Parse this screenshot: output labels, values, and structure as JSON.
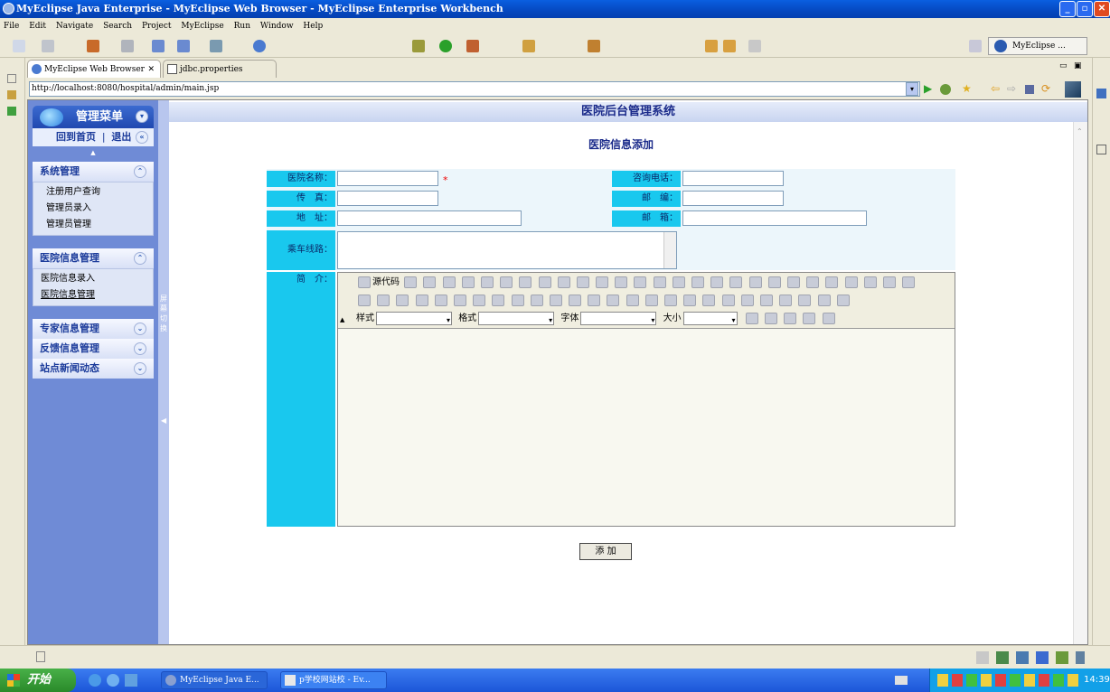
{
  "window": {
    "title": "MyEclipse Java Enterprise - MyEclipse Web Browser - MyEclipse Enterprise Workbench"
  },
  "menu": [
    "File",
    "Edit",
    "Navigate",
    "Search",
    "Project",
    "MyEclipse",
    "Run",
    "Window",
    "Help"
  ],
  "perspective": {
    "label": "MyEclipse ..."
  },
  "tabs": [
    {
      "label": "MyEclipse Web Browser"
    },
    {
      "label": "jdbc.properties"
    }
  ],
  "url": "http://localhost:8080/hospital/admin/main.jsp",
  "page": {
    "header": "医院后台管理系统",
    "form_title": "医院信息添加"
  },
  "sidebar": {
    "title": "管理菜单",
    "home": "回到首页",
    "sep": "|",
    "logout": "退出",
    "groups": [
      {
        "title": "系统管理",
        "items": [
          "注册用户查询",
          "管理员录入",
          "管理员管理"
        ]
      },
      {
        "title": "医院信息管理",
        "items": [
          "医院信息录入",
          "医院信息管理"
        ]
      },
      {
        "title": "专家信息管理"
      },
      {
        "title": "反馈信息管理"
      },
      {
        "title": "站点新闻动态"
      }
    ],
    "splitter_text": "屏幕切换"
  },
  "form": {
    "name_label": "医院名称：",
    "required": "*",
    "phone_label": "咨询电话：",
    "fax_label": "传　真：",
    "zip_label": "邮　编：",
    "address_label": "地　址：",
    "email_label": "邮　箱：",
    "bus_label": "乘车线路：",
    "intro_label": "简　介：",
    "submit": "添 加"
  },
  "editor": {
    "source_label": "源代码",
    "style_label": "样式",
    "format_label": "格式",
    "font_label": "字体",
    "size_label": "大小"
  },
  "taskbar": {
    "start": "开始",
    "task1": "MyEclipse Java E...",
    "task2": "p学校网站校 - Ev...",
    "clock": "14:39"
  }
}
